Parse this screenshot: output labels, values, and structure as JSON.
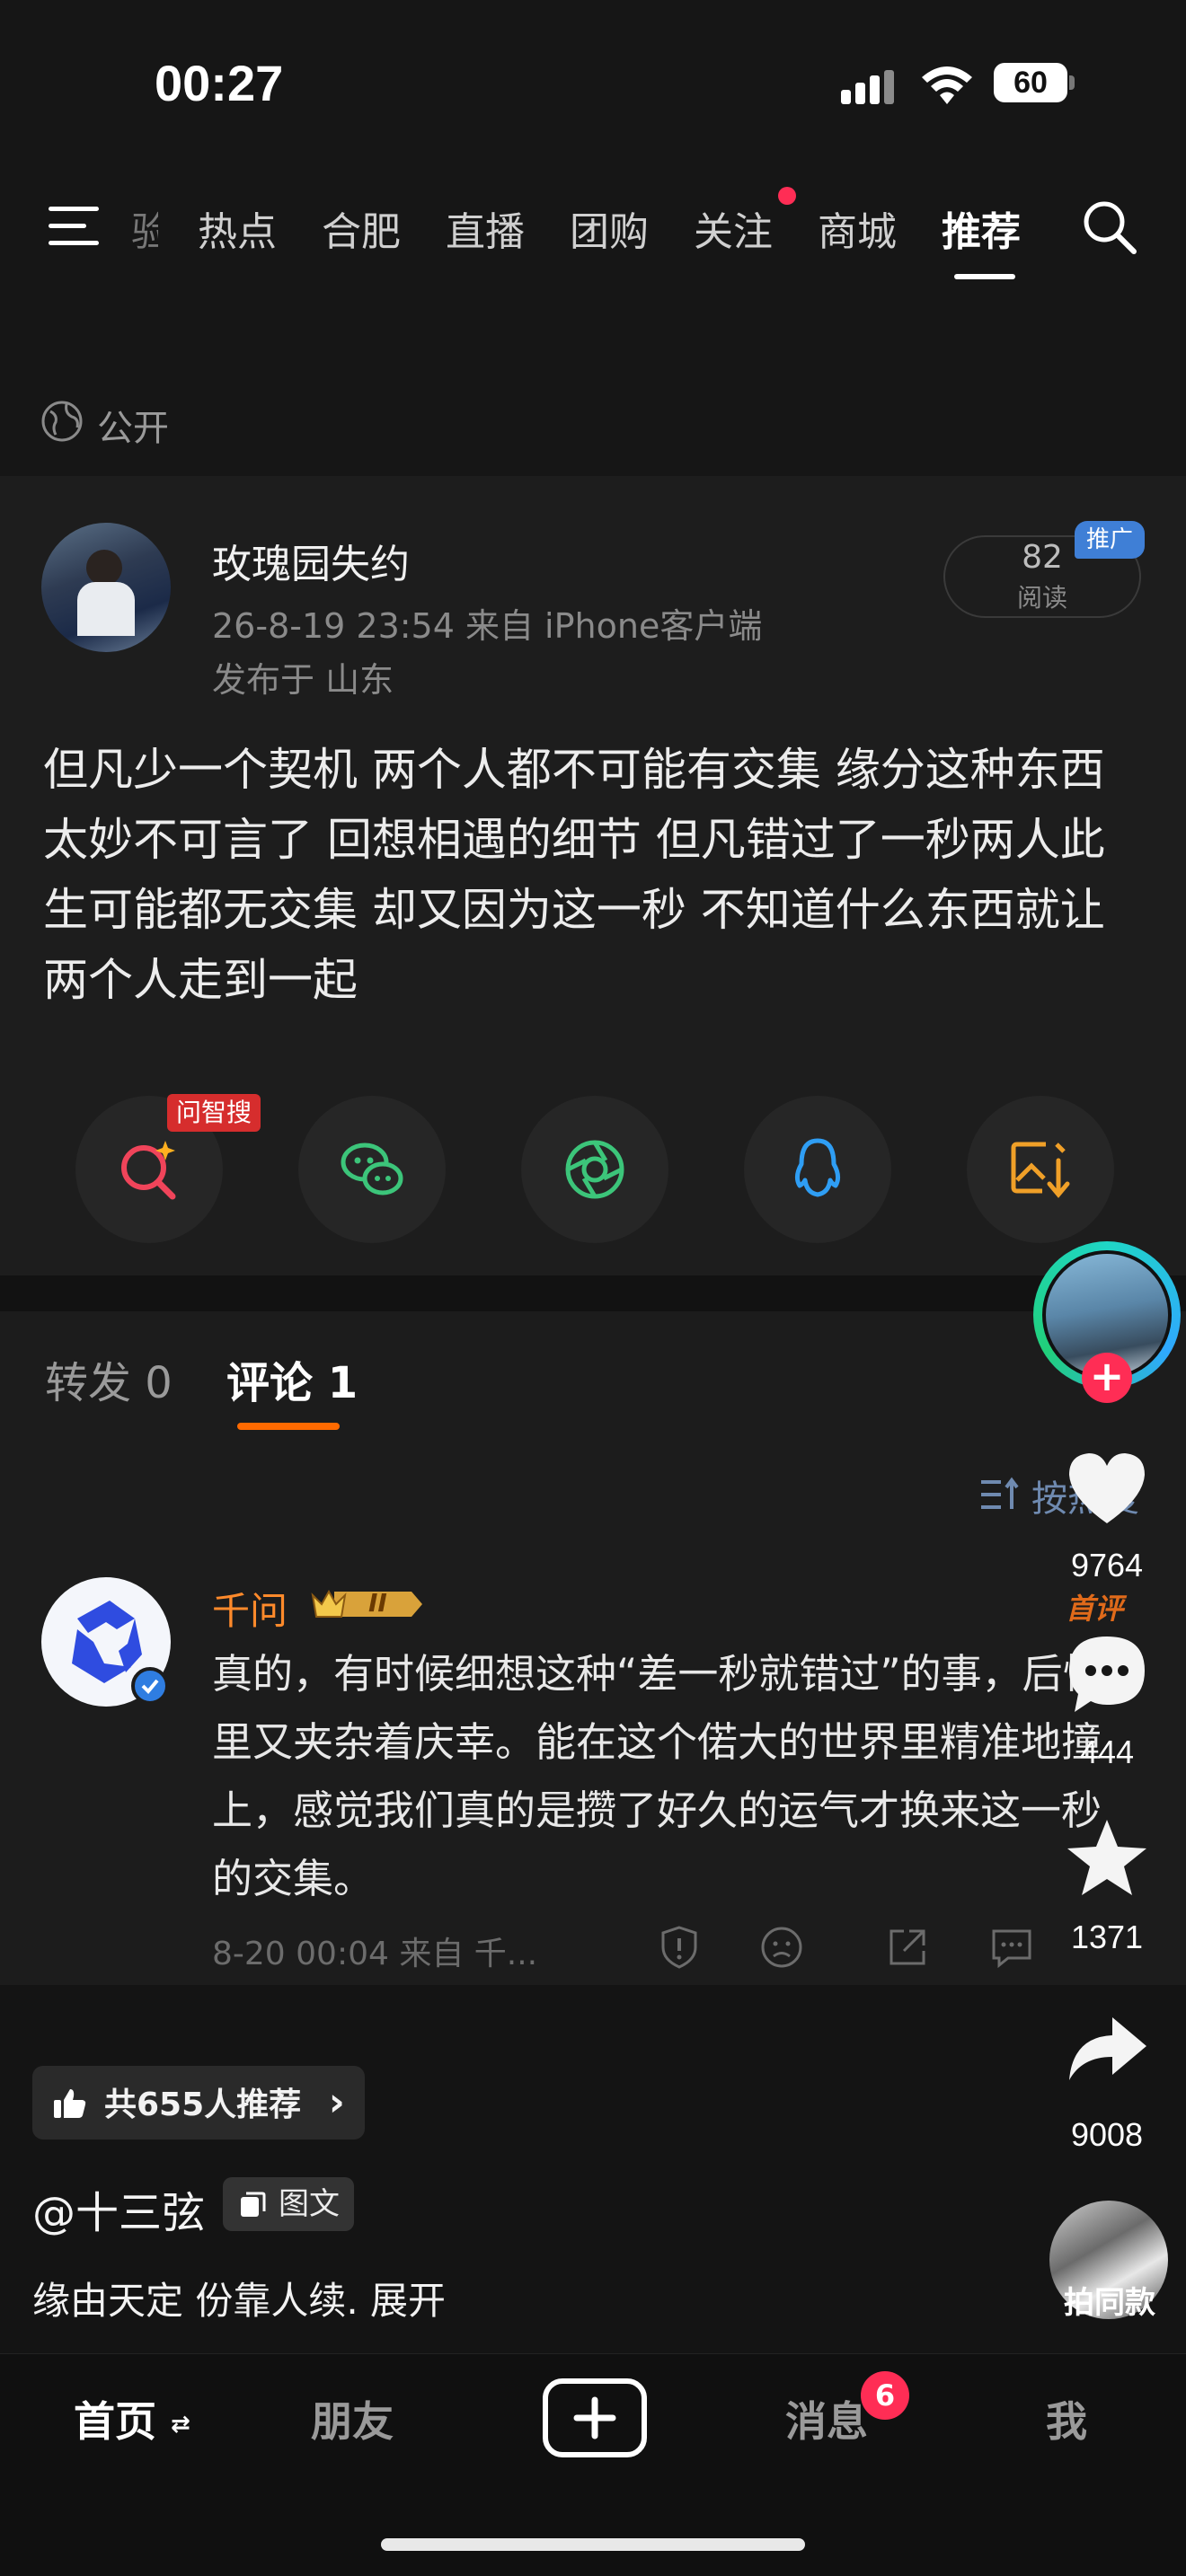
{
  "status_bar": {
    "time": "00:27",
    "battery": "60"
  },
  "nav": {
    "tabs": [
      {
        "label": "热点"
      },
      {
        "label": "合肥"
      },
      {
        "label": "直播"
      },
      {
        "label": "团购"
      },
      {
        "label": "关注"
      },
      {
        "label": "商城"
      },
      {
        "label": "推荐"
      }
    ],
    "partial_tab": "验"
  },
  "visibility": "公开",
  "post": {
    "author": "玫瑰园失约",
    "meta": "26-8-19 23:54  来自 iPhone客户端",
    "location": "发布于 山东",
    "reads_count": "82",
    "reads_label": "阅读",
    "promo_tag": "推广",
    "body": "但凡少一个契机 两个人都不可能有交集 缘分这种东西太妙不可言了 回想相遇的细节 但凡错过了一秒两人此生可能都无交集 却又因为这一秒 不知道什么东西就让两个人走到一起"
  },
  "share": {
    "zhisou_tag": "问智搜"
  },
  "comments_section": {
    "tab_repost": "转发 0",
    "tab_comment": "评论 1",
    "sort_label": "按热度"
  },
  "comment": {
    "name": "千问",
    "level": "II",
    "first_badge": "首评",
    "body": "真的，有时候细想这种“差一秒就错过”的事，后怕里又夹杂着庆幸。能在这个偌大的世界里精准地撞上，感觉我们真的是攒了好久的运气才换来这一秒的交集。",
    "meta": "8-20 00:04  来自 千..."
  },
  "overlay": {
    "recommend": "共655人推荐",
    "recommend_arrow": "›",
    "handle": "@十三弦",
    "type": "图文",
    "caption": "缘由天定 份靠人续. 展开"
  },
  "rail": {
    "likes": "9764",
    "comments": "444",
    "favorites": "1371",
    "shares": "9008",
    "same_style": "拍同款",
    "follow_plus": "+"
  },
  "tabbar": {
    "home": "首页",
    "friends": "朋友",
    "messages": "消息",
    "messages_badge": "6",
    "me": "我"
  },
  "colors": {
    "accent_orange": "#ff6a00",
    "badge_red": "#ff2d55",
    "link_blue": "#6f8ab0"
  }
}
